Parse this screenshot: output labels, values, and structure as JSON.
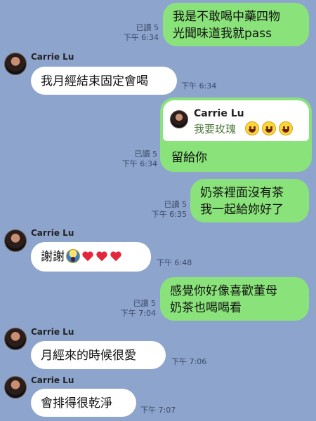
{
  "contact": {
    "name": "Carrie Lu"
  },
  "messages": [
    {
      "type": "out",
      "text": "我是不敢喝中藥四物\n光聞味道我就pass",
      "read": "已讀 5",
      "time": "下午 6:34"
    },
    {
      "type": "in",
      "sender": "Carrie Lu",
      "text": "我月經結束固定會喝",
      "time": "下午 6:34"
    },
    {
      "type": "out",
      "reply_to": {
        "name": "Carrie Lu",
        "text": "我要玫瑰"
      },
      "text": "留給你",
      "read": "已讀 5",
      "time": "下午 6:34"
    },
    {
      "type": "out",
      "text": "奶茶裡面沒有茶\n我一起給妳好了",
      "read": "已讀 5",
      "time": "下午 6:35"
    },
    {
      "type": "in",
      "sender": "Carrie Lu",
      "text": "謝謝",
      "time": "下午 6:48"
    },
    {
      "type": "out",
      "text": "感覺你好像喜歡董母\n奶茶也喝喝看",
      "read": "已讀 5",
      "time": "下午 7:04"
    },
    {
      "type": "in",
      "sender": "Carrie Lu",
      "text": "月經來的時候很愛",
      "time": "下午 7:06"
    },
    {
      "type": "in",
      "sender": "Carrie Lu",
      "text": "會排得很乾淨",
      "time": "下午 7:07"
    }
  ],
  "colors": {
    "background": "#8da4cd",
    "outgoing_bubble": "#8ae37a",
    "incoming_bubble": "#ffffff"
  },
  "icons": {
    "emoji_reply": "grinning-face-icon",
    "emoji_thanks": [
      "screaming-face-icon",
      "red-heart-icon"
    ]
  }
}
